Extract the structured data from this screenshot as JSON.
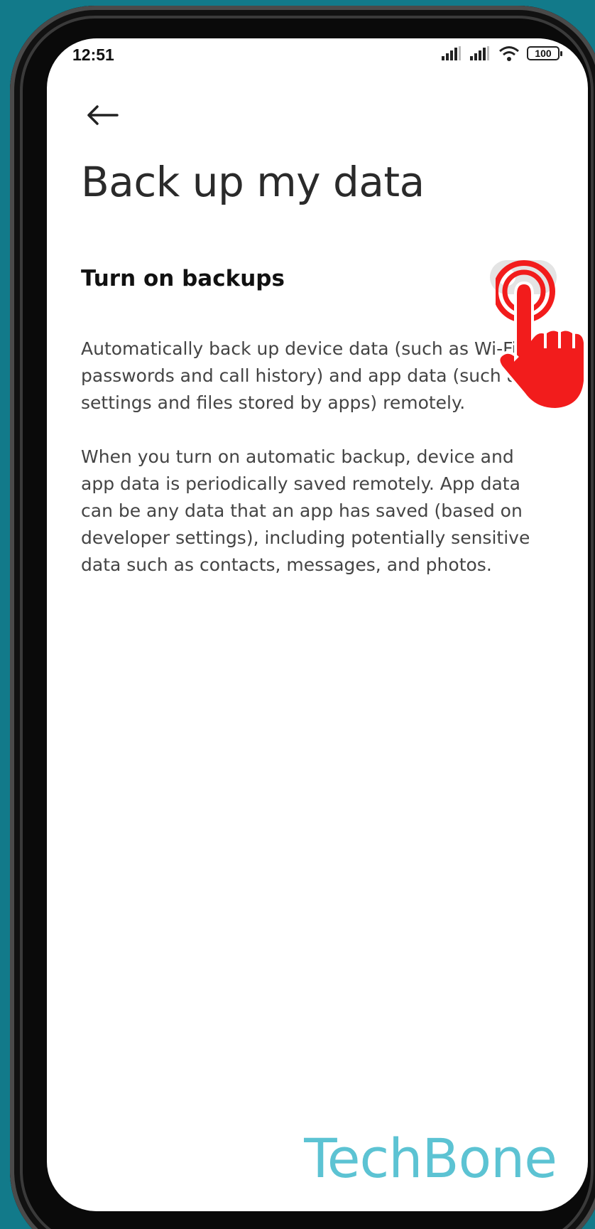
{
  "status_bar": {
    "time": "12:51",
    "battery": "100"
  },
  "header": {
    "back_icon": "arrow-left-icon",
    "title": "Back up my data"
  },
  "setting": {
    "label": "Turn on backups",
    "toggle_state": "off"
  },
  "description": {
    "paragraph_1": "Automatically back up device data (such as Wi-Fi passwords and call history) and app data (such as settings and files stored by apps) remotely.",
    "paragraph_2": "When you turn on automatic backup, device and app data is periodically saved remotely. App data can be any data that an app has saved (based on developer settings), including potentially sensitive data such as contacts, messages, and photos."
  },
  "overlay": {
    "icon": "tap-hand-icon",
    "color": "#f21c1c"
  },
  "watermark": {
    "text": "TechBone",
    "color": "#5cc3d3"
  }
}
